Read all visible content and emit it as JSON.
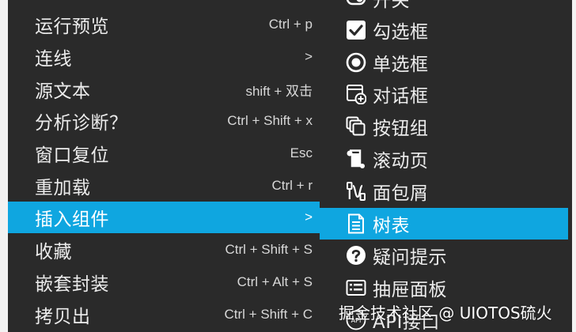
{
  "main_menu": {
    "items": [
      {
        "label": "运行预览",
        "shortcut": "Ctrl + p"
      },
      {
        "label": "连线",
        "shortcut": ">"
      },
      {
        "label": "源文本",
        "shortcut": "shift + 双击"
      },
      {
        "label": "分析诊断？",
        "shortcut": "Ctrl + Shift + x"
      },
      {
        "label": "窗口复位",
        "shortcut": "Esc"
      },
      {
        "label": "重加载",
        "shortcut": "Ctrl + r"
      },
      {
        "label": "插入组件",
        "shortcut": ">"
      },
      {
        "label": "收藏",
        "shortcut": "Ctrl + Shift + S"
      },
      {
        "label": "嵌套封装",
        "shortcut": "Ctrl + Alt + S"
      },
      {
        "label": "拷贝出",
        "shortcut": "Ctrl + Shift + C"
      }
    ]
  },
  "sub_menu": {
    "items": [
      {
        "label": "开关",
        "icon": "toggle-icon"
      },
      {
        "label": "勾选框",
        "icon": "checkbox-icon"
      },
      {
        "label": "单选框",
        "icon": "radio-icon"
      },
      {
        "label": "对话框",
        "icon": "dialog-add-icon"
      },
      {
        "label": "按钮组",
        "icon": "copy-stack-icon"
      },
      {
        "label": "滚动页",
        "icon": "scroll-icon"
      },
      {
        "label": "面包屑",
        "icon": "breadcrumb-icon"
      },
      {
        "label": "树表",
        "icon": "document-lines-icon"
      },
      {
        "label": "疑问提示",
        "icon": "question-icon"
      },
      {
        "label": "抽屉面板",
        "icon": "drawer-icon"
      },
      {
        "label": "API接口",
        "icon": "api-icon"
      }
    ]
  },
  "watermark": "掘金技术社区 @ UIOTOS硫火",
  "colors": {
    "menu_bg": "#2a2a2a",
    "highlight": "#0fa6e0",
    "text": "#ececec"
  }
}
